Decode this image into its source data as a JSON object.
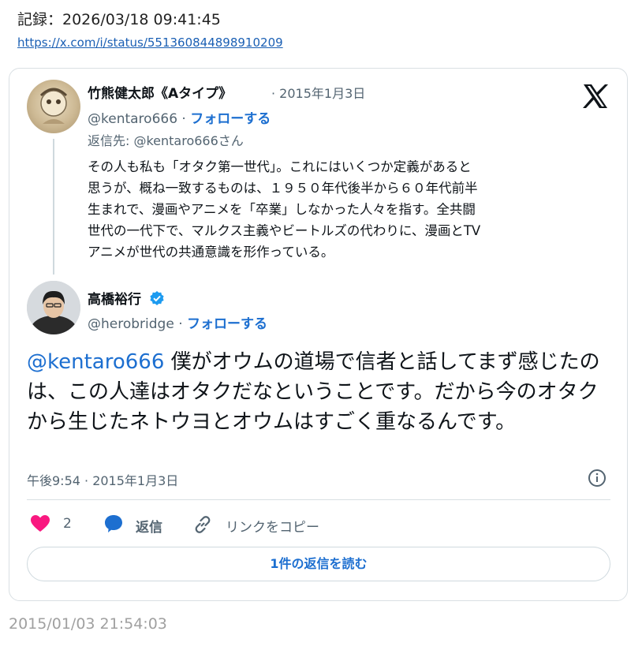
{
  "record": {
    "header": "記録：2026/03/18 09:41:45",
    "url": "https://x.com/i/status/551360844898910209"
  },
  "icons": {
    "logo": "x-logo-icon",
    "verified": "verified-badge-icon",
    "info": "info-icon",
    "like": "heart-icon",
    "reply": "reply-bubble-icon",
    "link": "link-icon"
  },
  "colors": {
    "accent": "#1d6fd0",
    "like": "#f91880",
    "muted": "#536471"
  },
  "quoted_tweet": {
    "author_name": "竹熊健太郎《Aタイプ》",
    "date": "· 2015年1月3日",
    "handle": "@kentaro666 ·",
    "follow": "フォローする",
    "reply_to": "返信先: @kentaro666さん",
    "lines": [
      "その人も私も「オタク第一世代」。これにはいくつか定義があると",
      "思うが、概ね一致するものは、１９５０年代後半から６０年代前半",
      "生まれで、漫画やアニメを「卒業」しなかった人々を指す。全共闘",
      "世代の一代下で、マルクス主義やビートルズの代わりに、漫画とTV",
      "アニメが世代の共通意識を形作っている。"
    ]
  },
  "main_tweet": {
    "author_name": "高橋裕行",
    "handle": "@herobridge ·",
    "follow": "フォローする",
    "mention": "@kentaro666",
    "text": " 僕がオウムの道場で信者と話してまず感じたのは、この人達はオタクだなということです。だから今のオタクから生じたネトウヨとオウムはすごく重なるんです。",
    "timestamp": "午後9:54 · 2015年1月3日"
  },
  "actions": {
    "like_count": "2",
    "reply_label": "返信",
    "copy_link_label": "リンクをコピー",
    "read_replies_label": "1件の返信を読む"
  },
  "footer": {
    "date": "2015/01/03 21:54:03"
  }
}
